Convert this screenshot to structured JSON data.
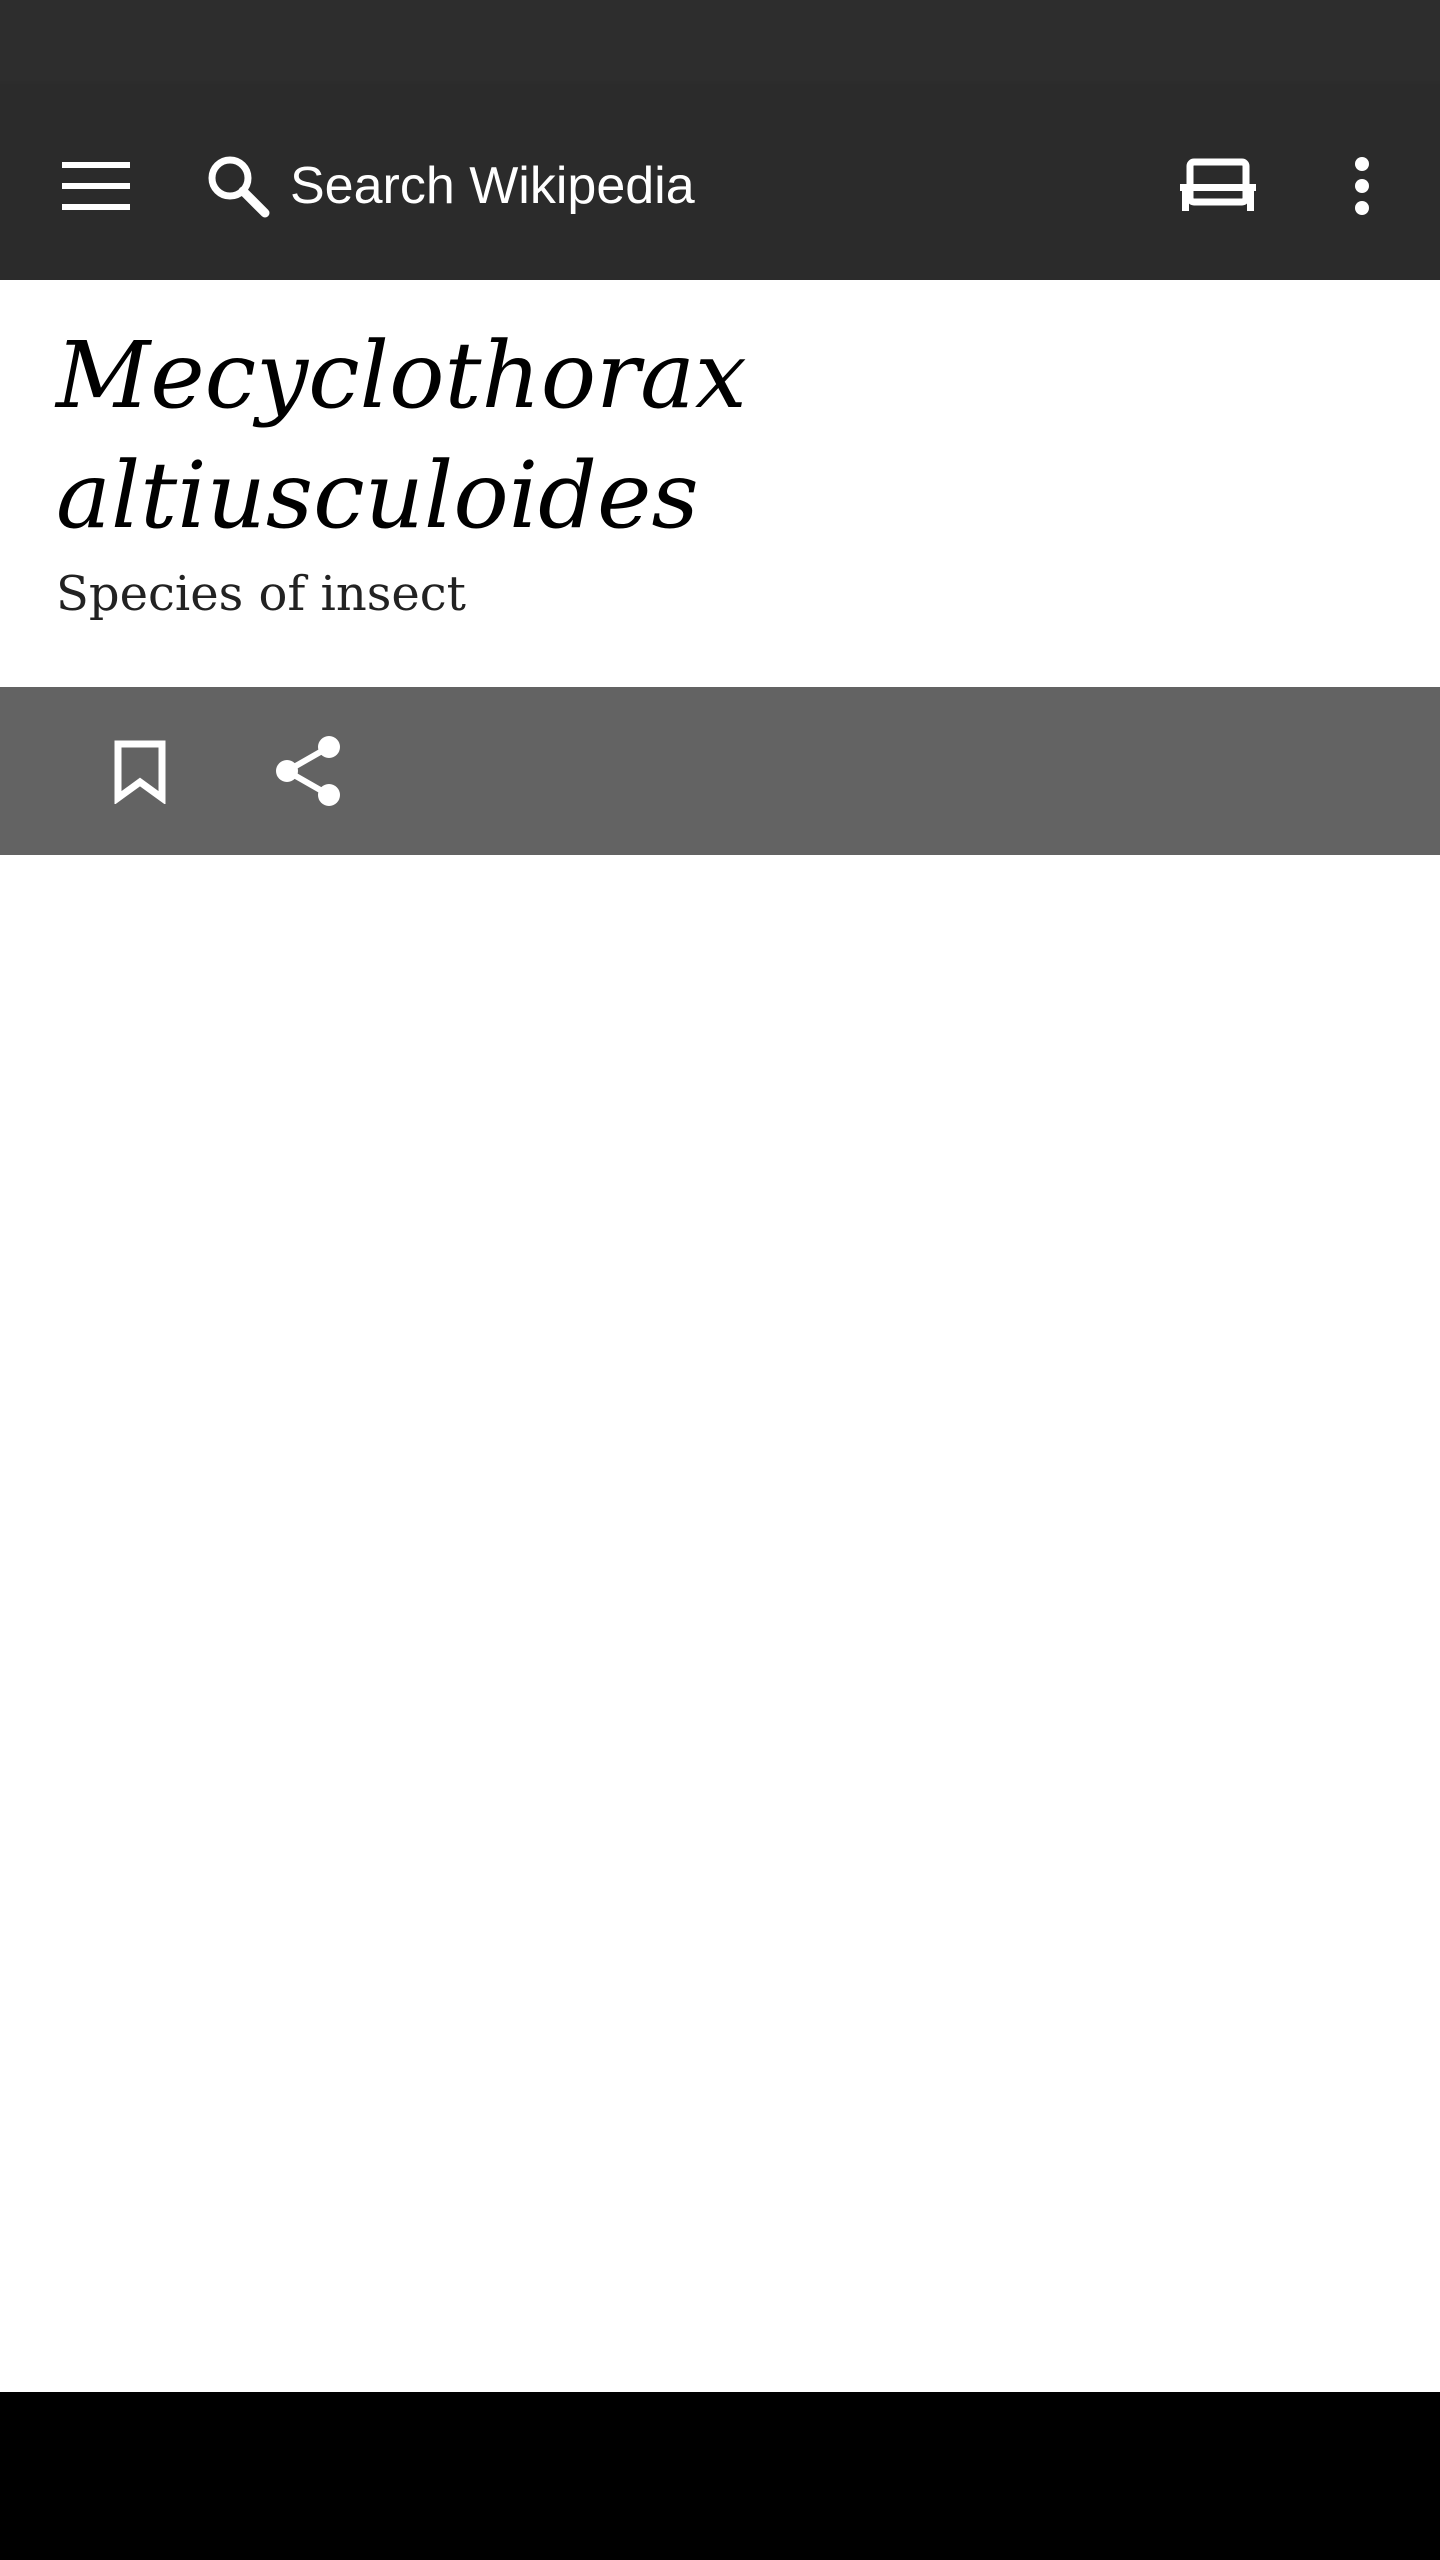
{
  "search": {
    "placeholder": "Search Wikipedia"
  },
  "article": {
    "title_line1": "Mecyclothorax",
    "title_line2": "altiusculoides",
    "description": "Species of insect"
  },
  "icons": {
    "menu": "hamburger-menu-icon",
    "search": "search-icon",
    "tabs": "tabs-icon",
    "overflow": "more-vertical-icon",
    "bookmark": "bookmark-icon",
    "share": "share-icon"
  },
  "colors": {
    "app_bar": "#2b2b2b",
    "status_bar": "#2d2d2d",
    "action_bar": "#636363",
    "nav_bar": "#000000"
  }
}
